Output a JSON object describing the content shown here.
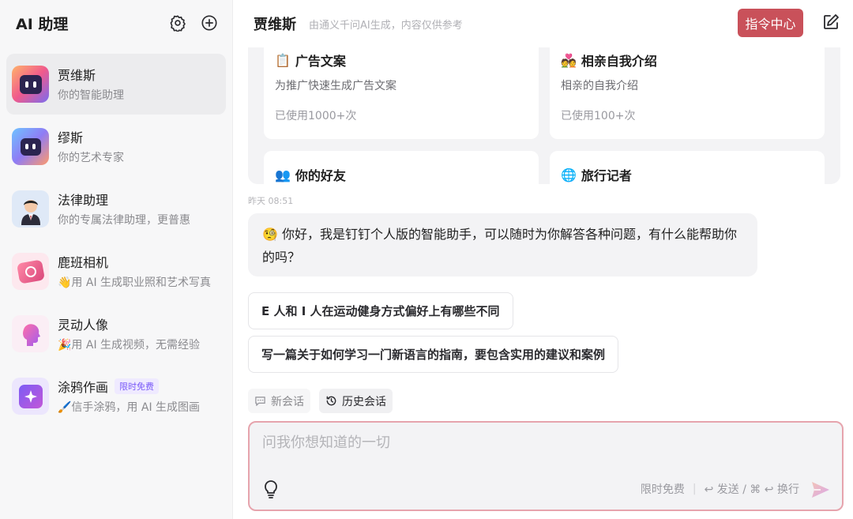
{
  "sidebar": {
    "title": "AI 助理",
    "agents": [
      {
        "name": "贾维斯",
        "desc": "你的智能助理",
        "badge": ""
      },
      {
        "name": "缪斯",
        "desc": "你的艺术专家",
        "badge": ""
      },
      {
        "name": "法律助理",
        "desc": "你的专属法律助理，更普惠",
        "badge": ""
      },
      {
        "name": "鹿班相机",
        "desc": "👋用 AI 生成职业照和艺术写真",
        "badge": ""
      },
      {
        "name": "灵动人像",
        "desc": "🎉用 AI 生成视频，无需经验",
        "badge": ""
      },
      {
        "name": "涂鸦作画",
        "desc": "🖌️信手涂鸦，用 AI 生成图画",
        "badge": "限时免费"
      }
    ]
  },
  "header": {
    "name": "贾维斯",
    "subtitle": "由通义千问AI生成，内容仅供参考",
    "command_center": "指令中心"
  },
  "cards": [
    {
      "emoji": "📋",
      "title": "广告文案",
      "desc": "为推广快速生成广告文案",
      "used": "已使用1000+次"
    },
    {
      "emoji": "💑",
      "title": "相亲自我介绍",
      "desc": "相亲的自我介绍",
      "used": "已使用100+次"
    },
    {
      "emoji": "👥",
      "title": "你的好友",
      "desc": "",
      "used": ""
    },
    {
      "emoji": "🌐",
      "title": "旅行记者",
      "desc": "",
      "used": ""
    }
  ],
  "chat": {
    "timestamp": "昨天 08:51",
    "greeting": "🧐 你好，我是钉钉个人版的智能助手，可以随时为你解答各种问题，有什么能帮助你的吗？",
    "suggestions": [
      "E 人和 I 人在运动健身方式偏好上有哪些不同",
      "写一篇关于如何学习一门新语言的指南，要包含实用的建议和案例"
    ],
    "new_session": "新会话",
    "history": "历史会话"
  },
  "input": {
    "placeholder": "问我你想知道的一切",
    "free_label": "限时免费",
    "send_hint": "↩ 发送 / ⌘ ↩ 换行"
  },
  "colors": {
    "accent": "#c9515a",
    "input_border": "#e6a4ad",
    "badge": "#7a5af8"
  }
}
